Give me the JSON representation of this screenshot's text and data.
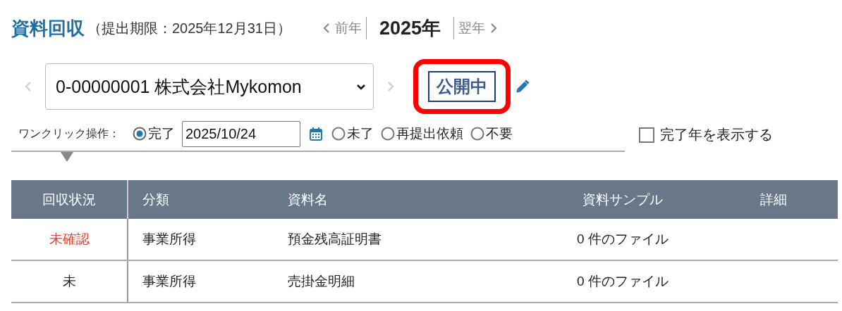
{
  "header": {
    "title": "資料回収",
    "deadline": "（提出期限：2025年12月31日）",
    "prev_year": "前年",
    "current_year": "2025年",
    "next_year": "翌年"
  },
  "client_bar": {
    "prev_disabled": true,
    "client": "0-00000001 株式会社Mykomon",
    "next_disabled": true,
    "status_badge": "公開中",
    "highlighted": true
  },
  "one_click": {
    "label": "ワンクリック操作：",
    "options": [
      {
        "label": "完了",
        "selected": true,
        "date": "2025/10/24"
      },
      {
        "label": "未了",
        "selected": false
      },
      {
        "label": "再提出依頼",
        "selected": false
      },
      {
        "label": "不要",
        "selected": false
      }
    ]
  },
  "show_completed_year": {
    "label": "完了年を表示する",
    "checked": false
  },
  "table": {
    "columns": [
      "回収状況",
      "分類",
      "資料名",
      "資料サンプル",
      "詳細"
    ],
    "rows": [
      {
        "status": "未確認",
        "color": "#d9452c",
        "category": "事業所得",
        "name": "預金残高証明書",
        "sample": "0 件のファイル"
      },
      {
        "status": "未",
        "color": "#222222",
        "category": "事業所得",
        "name": "売掛金明細",
        "sample": "0 件のファイル"
      }
    ]
  }
}
